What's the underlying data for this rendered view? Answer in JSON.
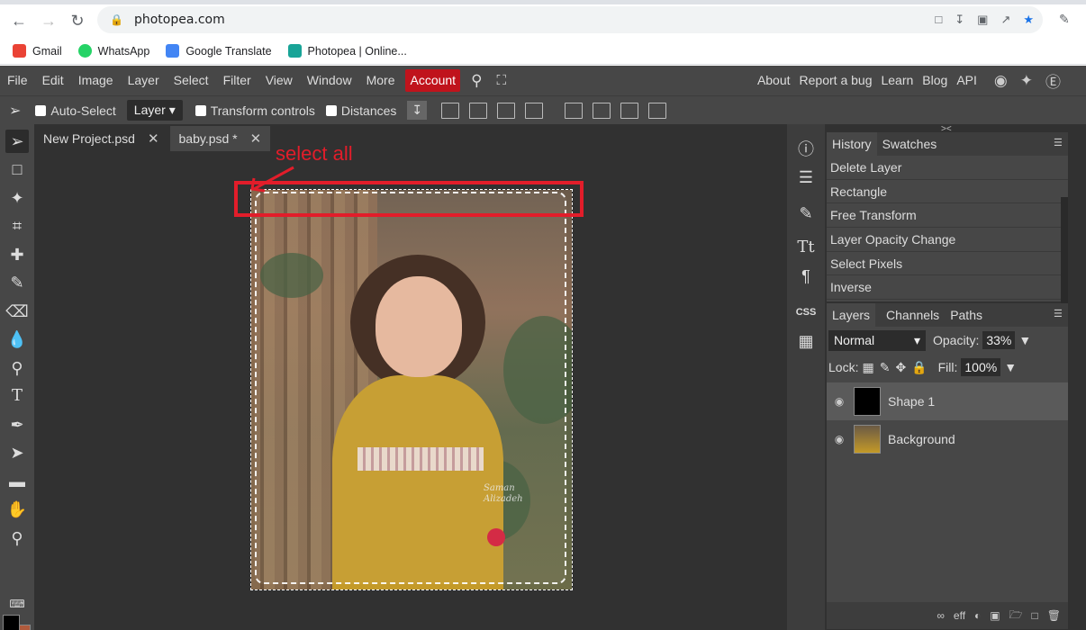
{
  "browser": {
    "url": "photopea.com",
    "bookmarks": [
      {
        "label": "Gmail",
        "color": "#ea4335"
      },
      {
        "label": "WhatsApp",
        "color": "#25d366"
      },
      {
        "label": "Google Translate",
        "color": "#4285f4"
      },
      {
        "label": "Photopea | Online...",
        "color": "#18a497"
      }
    ]
  },
  "menu": {
    "items": [
      "File",
      "Edit",
      "Image",
      "Layer",
      "Select",
      "Filter",
      "View",
      "Window",
      "More"
    ],
    "account": "Account",
    "right_items": [
      "About",
      "Report a bug",
      "Learn",
      "Blog",
      "API"
    ]
  },
  "options": {
    "auto_select": "Auto-Select",
    "layer_mode": "Layer",
    "transform_controls": "Transform controls",
    "distances": "Distances"
  },
  "tabs": [
    {
      "label": "New Project.psd"
    },
    {
      "label": "baby.psd *"
    }
  ],
  "annotation": {
    "text": "select all"
  },
  "signature": {
    "line1": "Saman",
    "line2": "Alizadeh"
  },
  "history": {
    "tabs": [
      "History",
      "Swatches"
    ],
    "items": [
      "Delete Layer",
      "Rectangle",
      "Free Transform",
      "Layer Opacity Change",
      "Select Pixels",
      "Inverse"
    ]
  },
  "layers": {
    "tabs": [
      "Layers",
      "Channels",
      "Paths"
    ],
    "blend_mode": "Normal",
    "opacity_label": "Opacity:",
    "opacity": "33%",
    "lock_label": "Lock:",
    "fill_label": "Fill:",
    "fill": "100%",
    "items": [
      {
        "name": "Shape 1"
      },
      {
        "name": "Background"
      }
    ]
  },
  "colors": {
    "account_red": "#c0131c",
    "annotation_red": "#e21d2a",
    "foreground": "#000000",
    "background": "#b05a3c"
  }
}
